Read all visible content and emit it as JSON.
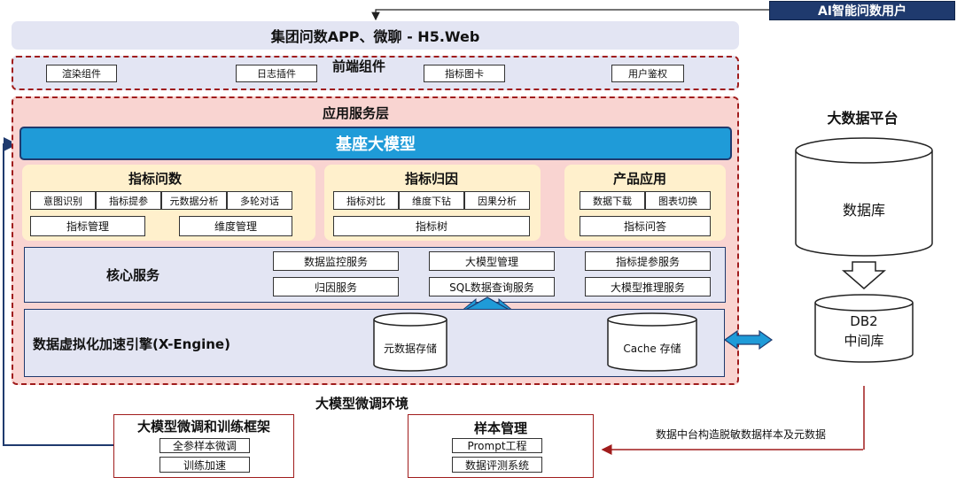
{
  "user_badge": "AI智能问数用户",
  "top_bar": "集团问数APP、微聊 - H5.Web",
  "frontend": {
    "title": "前端组件",
    "items": [
      "渲染组件",
      "日志插件",
      "指标图卡",
      "用户鉴权"
    ]
  },
  "app_layer": {
    "title": "应用服务层",
    "foundation_model": "基座大模型",
    "indicator_query": {
      "title": "指标问数",
      "row1": [
        "意图识别",
        "指标提参",
        "元数据分析",
        "多轮对话"
      ],
      "row2": [
        "指标管理",
        "维度管理"
      ]
    },
    "indicator_attribution": {
      "title": "指标归因",
      "row1": [
        "指标对比",
        "维度下钻",
        "因果分析"
      ],
      "row2": [
        "指标树"
      ]
    },
    "product_app": {
      "title": "产品应用",
      "row1": [
        "数据下载",
        "图表切换"
      ],
      "row2": [
        "指标问答"
      ]
    },
    "core_services": {
      "title": "核心服务",
      "items": [
        "数据监控服务",
        "大模型管理",
        "指标提参服务",
        "归因服务",
        "SQL数据查询服务",
        "大模型推理服务"
      ]
    },
    "xengine": {
      "title": "数据虚拟化加速引擎(X-Engine)",
      "store1": "元数据存储",
      "store2": "Cache 存储"
    }
  },
  "bigdata": {
    "title": "大数据平台",
    "db": "数据库",
    "db2_line1": "DB2",
    "db2_line2": "中间库"
  },
  "finetune": {
    "title": "大模型微调环境",
    "framework": {
      "title": "大模型微调和训练框架",
      "items": [
        "全参样本微调",
        "训练加速"
      ]
    },
    "sample_mgmt": {
      "title": "样本管理",
      "items": [
        "Prompt工程",
        "数据评测系统"
      ]
    },
    "note": "数据中台构造脱敏数据样本及元数据"
  },
  "colors": {
    "dark_blue": "#1f3a6e",
    "red": "#a01c1c",
    "pink_fill": "#f9d4d1",
    "lavender": "#e3e5f3",
    "yellow": "#fff0cc",
    "accent_blue": "#1f9bd8"
  }
}
